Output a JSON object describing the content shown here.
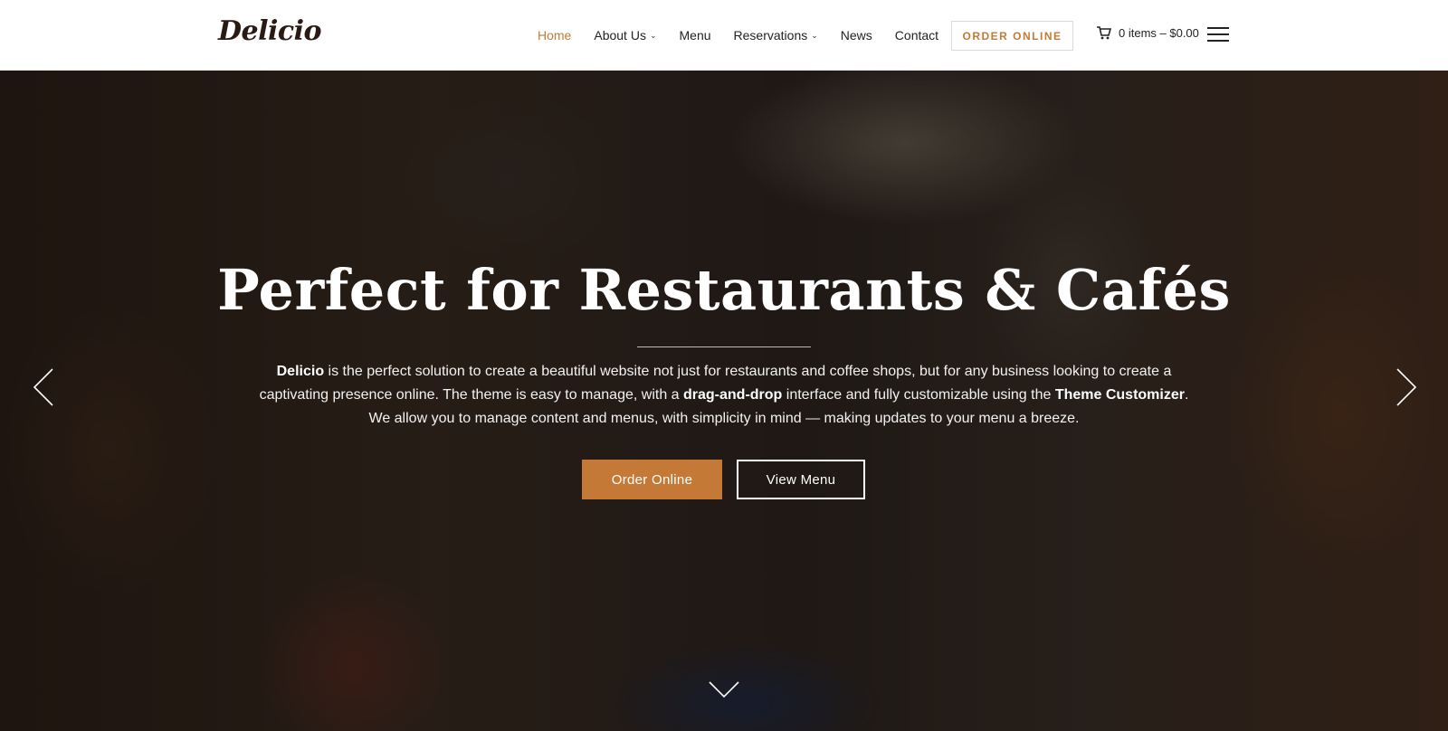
{
  "header": {
    "logo": "Delicio",
    "nav": [
      {
        "label": "Home",
        "active": true,
        "dropdown": false
      },
      {
        "label": "About Us",
        "active": false,
        "dropdown": true
      },
      {
        "label": "Menu",
        "active": false,
        "dropdown": false
      },
      {
        "label": "Reservations",
        "active": false,
        "dropdown": true
      },
      {
        "label": "News",
        "active": false,
        "dropdown": false
      },
      {
        "label": "Contact",
        "active": false,
        "dropdown": false
      }
    ],
    "order_button": "ORDER ONLINE",
    "cart_label": "0 items – $0.00",
    "icons": {
      "cart": "cart-icon",
      "menu": "hamburger-menu-icon",
      "dropdown": "chevron-down-icon"
    }
  },
  "hero": {
    "title": "Perfect for Restaurants & Cafés",
    "description": {
      "part1": "Delicio",
      "part2": " is the perfect solution to create a beautiful website not just for restaurants and coffee shops, but for any business looking to create a captivating presence online. The theme is easy to manage, with a ",
      "part3": "drag-and-drop",
      "part4": " interface and fully customizable using the ",
      "part5": "Theme Customizer",
      "part6": ". We allow you to manage content and menus, with simplicity in mind — making updates to your menu a breeze."
    },
    "primary_button": "Order Online",
    "secondary_button": "View Menu",
    "icons": {
      "prev": "chevron-left-icon",
      "next": "chevron-right-icon",
      "scroll": "chevron-down-icon"
    }
  },
  "colors": {
    "accent": "#c47a36",
    "text_dark": "#222222",
    "logo": "#2a1a14"
  }
}
